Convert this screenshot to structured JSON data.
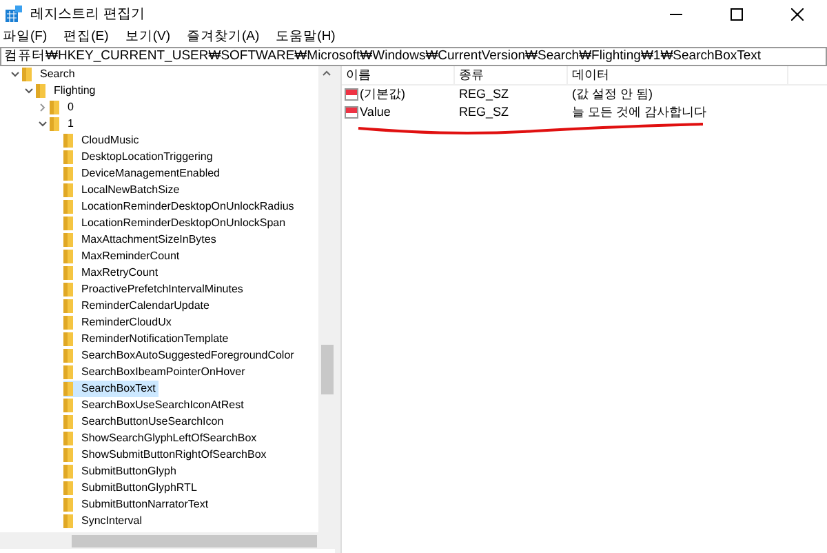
{
  "window": {
    "title": "레지스트리 편집기"
  },
  "menu": [
    "파일(F)",
    "편집(E)",
    "보기(V)",
    "즐겨찾기(A)",
    "도움말(H)"
  ],
  "address": "컴퓨터₩HKEY_CURRENT_USER₩SOFTWARE₩Microsoft₩Windows₩CurrentVersion₩Search₩Flighting₩1₩SearchBoxText",
  "tree": [
    {
      "label": "Search",
      "expanded": true,
      "selected": false,
      "children": [
        {
          "label": "Flighting",
          "expanded": true,
          "selected": false,
          "children": [
            {
              "label": "0",
              "expanded": false,
              "selected": false
            },
            {
              "label": "1",
              "expanded": true,
              "selected": false,
              "children": [
                {
                  "label": "CloudMusic",
                  "selected": false
                },
                {
                  "label": "DesktopLocationTriggering",
                  "selected": false
                },
                {
                  "label": "DeviceManagementEnabled",
                  "selected": false
                },
                {
                  "label": "LocalNewBatchSize",
                  "selected": false
                },
                {
                  "label": "LocationReminderDesktopOnUnlockRadius",
                  "selected": false
                },
                {
                  "label": "LocationReminderDesktopOnUnlockSpan",
                  "selected": false
                },
                {
                  "label": "MaxAttachmentSizeInBytes",
                  "selected": false
                },
                {
                  "label": "MaxReminderCount",
                  "selected": false
                },
                {
                  "label": "MaxRetryCount",
                  "selected": false
                },
                {
                  "label": "ProactivePrefetchIntervalMinutes",
                  "selected": false
                },
                {
                  "label": "ReminderCalendarUpdate",
                  "selected": false
                },
                {
                  "label": "ReminderCloudUx",
                  "selected": false
                },
                {
                  "label": "ReminderNotificationTemplate",
                  "selected": false
                },
                {
                  "label": "SearchBoxAutoSuggestedForegroundColor",
                  "selected": false
                },
                {
                  "label": "SearchBoxIbeamPointerOnHover",
                  "selected": false
                },
                {
                  "label": "SearchBoxText",
                  "selected": true
                },
                {
                  "label": "SearchBoxUseSearchIconAtRest",
                  "selected": false
                },
                {
                  "label": "SearchButtonUseSearchIcon",
                  "selected": false
                },
                {
                  "label": "ShowSearchGlyphLeftOfSearchBox",
                  "selected": false
                },
                {
                  "label": "ShowSubmitButtonRightOfSearchBox",
                  "selected": false
                },
                {
                  "label": "SubmitButtonGlyph",
                  "selected": false
                },
                {
                  "label": "SubmitButtonGlyphRTL",
                  "selected": false
                },
                {
                  "label": "SubmitButtonNarratorText",
                  "selected": false
                },
                {
                  "label": "SyncInterval",
                  "selected": false
                }
              ]
            }
          ]
        }
      ]
    }
  ],
  "table": {
    "columns": [
      "이름",
      "종류",
      "데이터"
    ],
    "rows": [
      {
        "name": "(기본값)",
        "type": "REG_SZ",
        "data": "(값 설정 안 됨)"
      },
      {
        "name": "Value",
        "type": "REG_SZ",
        "data": "늘 모든 것에 감사합니다"
      }
    ]
  }
}
